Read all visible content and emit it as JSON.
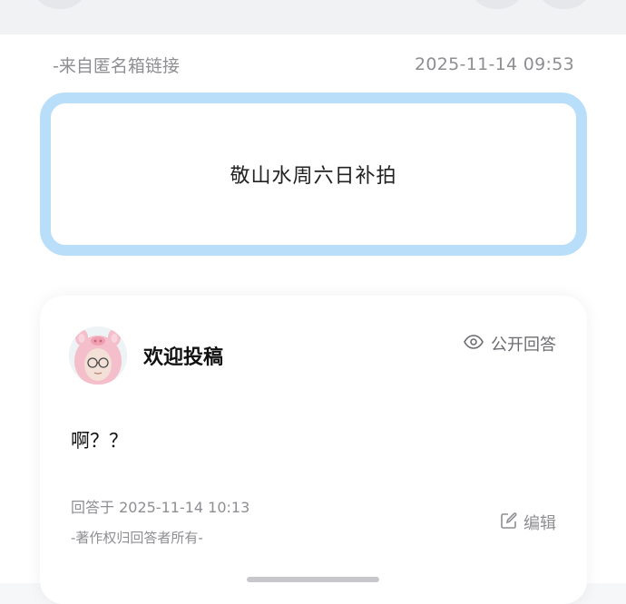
{
  "source": {
    "label": "-来自匿名箱链接",
    "datetime": "2025-11-14 09:53"
  },
  "question": {
    "text": "敬山水周六日补拍"
  },
  "answer": {
    "username": "欢迎投稿",
    "visibility_label": "公开回答",
    "content": "啊？？",
    "answered_at": "回答于 2025-11-14 10:13",
    "copyright": "-著作权归回答者所有-",
    "edit_label": "编辑"
  },
  "icons": {
    "visibility": "eye-icon",
    "edit": "edit-icon",
    "avatar": "avatar-pig-hood"
  },
  "colors": {
    "question_border": "#b9defa",
    "muted_text": "#8e8e93",
    "card_bg": "#ffffff"
  }
}
